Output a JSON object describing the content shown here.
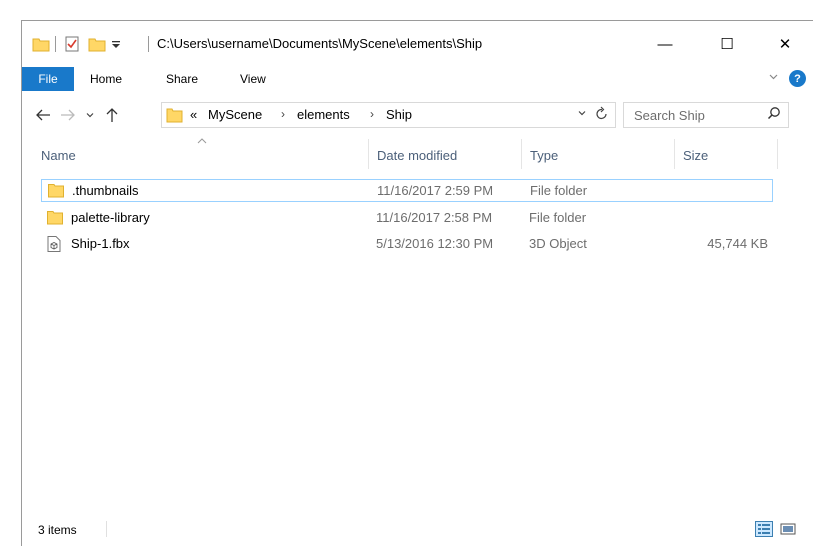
{
  "window": {
    "title": "C:\\Users\\username\\Documents\\MyScene\\elements\\Ship",
    "controls": {
      "minimize": "—",
      "maximize": "☐",
      "close": "✕"
    }
  },
  "ribbon": {
    "tabs": {
      "file": "File",
      "home": "Home",
      "share": "Share",
      "view": "View"
    },
    "help": "?"
  },
  "address": {
    "overflow": "«",
    "breadcrumbs": [
      "MyScene",
      "elements",
      "Ship"
    ],
    "separator": "›"
  },
  "search": {
    "placeholder": "Search Ship"
  },
  "columns": {
    "name": "Name",
    "date": "Date modified",
    "type": "Type",
    "size": "Size"
  },
  "files": [
    {
      "name": ".thumbnails",
      "date": "11/16/2017 2:59 PM",
      "type": "File folder",
      "size": "",
      "icon": "folder-icon",
      "selected": true
    },
    {
      "name": "palette-library",
      "date": "11/16/2017 2:58 PM",
      "type": "File folder",
      "size": "",
      "icon": "folder-icon",
      "selected": false
    },
    {
      "name": "Ship-1.fbx",
      "date": "5/13/2016 12:30 PM",
      "type": "3D Object",
      "size": "45,744 KB",
      "icon": "3d-object-file-icon",
      "selected": false
    }
  ],
  "status": {
    "item_count": "3 items"
  },
  "colors": {
    "accent": "#1979ca",
    "selection_border": "#99d1ff",
    "header_text": "#4c607a",
    "folder": "#ffd766"
  }
}
